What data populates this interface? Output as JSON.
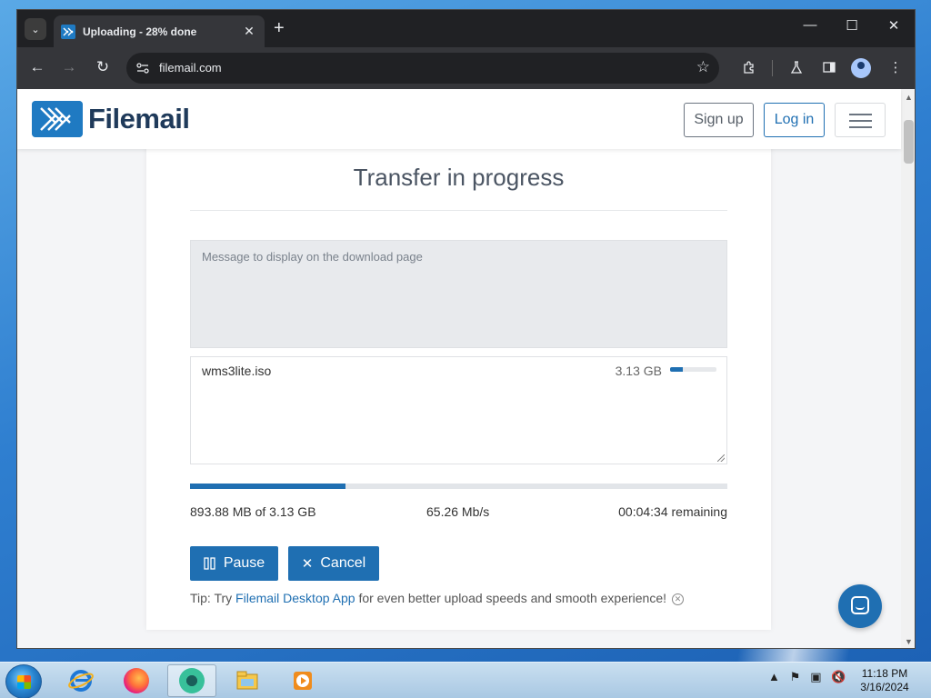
{
  "browser": {
    "tab_title": "Uploading - 28% done",
    "tab_close": "✕",
    "new_tab": "+",
    "url": "filemail.com",
    "window_controls": {
      "minimize": "—",
      "maximize": "☐",
      "close": "✕"
    },
    "icons": [
      "tab-search-icon",
      "filemail-favicon",
      "back-icon",
      "forward-icon",
      "reload-icon",
      "site-settings-icon",
      "star-icon",
      "extensions-icon",
      "labs-icon",
      "side-panel-icon",
      "profile-icon",
      "more-icon"
    ]
  },
  "site": {
    "logo_text": "Filemail",
    "signup_label": "Sign up",
    "login_label": "Log in"
  },
  "transfer": {
    "heading": "Transfer in progress",
    "message_placeholder": "Message to display on the download page",
    "file": {
      "name": "wms3lite.iso",
      "size": "3.13 GB",
      "progress": 0.28
    },
    "overall_progress": 0.29,
    "transferred": "893.88 MB of 3.13 GB",
    "speed": "65.26 Mb/s",
    "remaining": "00:04:34 remaining",
    "pause_label": "Pause",
    "cancel_label": "Cancel",
    "tip_prefix": "Tip: Try ",
    "tip_link": "Filemail Desktop App",
    "tip_suffix": " for even better upload speeds and smooth experience!"
  },
  "taskbar": {
    "time": "11:18 PM",
    "date": "3/16/2024",
    "apps": [
      "internet-explorer",
      "firefox",
      "chrome",
      "file-explorer",
      "media-player"
    ]
  },
  "colors": {
    "brand": "#1f6fb2",
    "text_muted": "#7a828c"
  }
}
